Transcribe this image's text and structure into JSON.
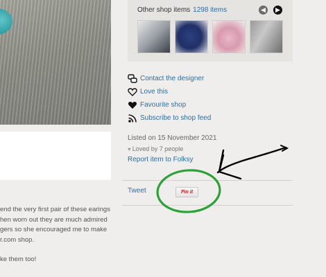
{
  "other_items": {
    "title": "Other shop items",
    "count": "1298 items",
    "prev_icon": "arrow-left-icon",
    "next_icon": "arrow-right-icon"
  },
  "links": [
    {
      "label": "Contact the designer",
      "icon": "contact-icon"
    },
    {
      "label": "Love this",
      "icon": "heart-outline-icon"
    },
    {
      "label": "Favourite shop",
      "icon": "heart-filled-icon"
    },
    {
      "label": "Subscribe to shop feed",
      "icon": "rss-icon"
    }
  ],
  "listing": {
    "listed_on": "Listed on 15 November 2021",
    "loved_by": "Loved by 7 people",
    "report": "Report item to Folksy"
  },
  "social": {
    "tweet": "Tweet",
    "pinit": "Pin it"
  },
  "description": {
    "lines": [
      "end the very first pair of these earings",
      "hen worn out they are much admired",
      "gers so she encouraged me to make",
      "r.com shop.",
      "",
      "ke them too!"
    ]
  },
  "colors": {
    "link": "#2b6ea6",
    "annotation_circle": "#2aa336",
    "annotation_arrow": "#000000"
  }
}
